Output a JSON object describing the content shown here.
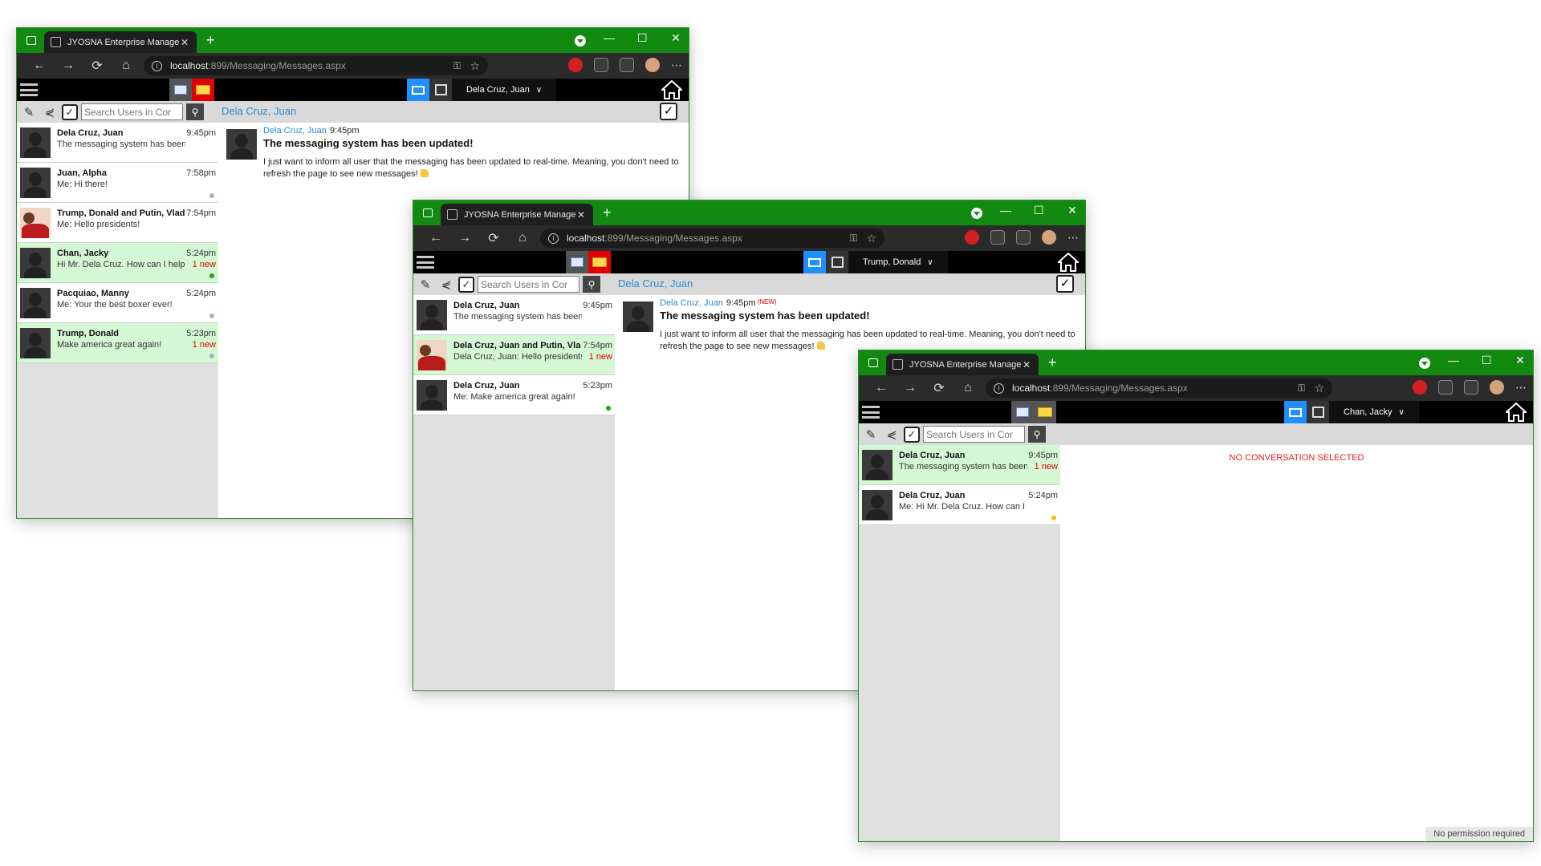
{
  "browser": {
    "tab_title": "JYOSNA Enterprise Management",
    "tab_close": "✕",
    "new_tab": "+",
    "url_host": "localhost",
    "url_path": ":899/Messaging/Messages.aspx",
    "back": "←",
    "forward": "→",
    "reload": "⟳",
    "home": "⌂",
    "menu": "⋯",
    "minimize": "—",
    "maximize": "☐",
    "close": "✕"
  },
  "app": {
    "search_placeholder": "Search Users in Cor",
    "new_message_glyph": "✎",
    "share_glyph": "⋞",
    "check_glyph": "✓",
    "search_glyph": "⚲",
    "chevron": "∨"
  },
  "win1": {
    "user": "Dela Cruz, Juan",
    "conversation_title": "Dela Cruz, Juan",
    "conversations": [
      {
        "name": "Dela Cruz, Juan",
        "time": "9:45pm",
        "preview": "The messaging system has been updated!",
        "new": "",
        "unread": false,
        "dot": ""
      },
      {
        "name": "Juan, Alpha",
        "time": "7:58pm",
        "preview": "Me: Hi there!",
        "new": "",
        "unread": false,
        "dot": "grey"
      },
      {
        "name": "Trump, Donald and Putin, Vladimir",
        "time": "7:54pm",
        "preview": "Me: Hello presidents!",
        "new": "",
        "unread": false,
        "dot": "",
        "group": true
      },
      {
        "name": "Chan, Jacky",
        "time": "5:24pm",
        "preview": "Hi Mr. Dela Cruz. How can I help you?",
        "new": "1 new",
        "unread": true,
        "dot": "green"
      },
      {
        "name": "Pacquiao, Manny",
        "time": "5:24pm",
        "preview": "Me: Your the best boxer ever!",
        "new": "",
        "unread": false,
        "dot": "grey"
      },
      {
        "name": "Trump, Donald",
        "time": "5:23pm",
        "preview": "Make america great again!",
        "new": "1 new",
        "unread": true,
        "dot": "grey"
      }
    ],
    "message": {
      "sender": "Dela Cruz, Juan",
      "time": "9:45pm",
      "new_tag": "",
      "subject": "The messaging system has been updated!",
      "body": "I just want to inform all user that the messaging has been updated to real-time. Meaning, you don't need to refresh the page to see new messages!"
    }
  },
  "win2": {
    "user": "Trump, Donald",
    "conversation_title": "Dela Cruz, Juan",
    "conversations": [
      {
        "name": "Dela Cruz, Juan",
        "time": "9:45pm",
        "preview": "The messaging system has been updated!",
        "new": "",
        "unread": false,
        "dot": ""
      },
      {
        "name": "Dela Cruz, Juan and Putin, Vladimir",
        "time": "7:54pm",
        "preview": "Dela Cruz, Juan: Hello presidents!",
        "new": "1 new",
        "unread": true,
        "dot": "",
        "group": true
      },
      {
        "name": "Dela Cruz, Juan",
        "time": "5:23pm",
        "preview": "Me: Make america great again!",
        "new": "",
        "unread": false,
        "dot": "green"
      }
    ],
    "message": {
      "sender": "Dela Cruz, Juan",
      "time": "9:45pm",
      "new_tag": "(NEW)",
      "subject": "The messaging system has been updated!",
      "body": "I just want to inform all user that the messaging has been updated to real-time. Meaning, you don't need to refresh the page to see new messages!"
    }
  },
  "win3": {
    "user": "Chan, Jacky",
    "no_conversation": "NO CONVERSATION SELECTED",
    "no_permission": "No permission required",
    "conversations": [
      {
        "name": "Dela Cruz, Juan",
        "time": "9:45pm",
        "preview": "The messaging system has been updated!",
        "new": "1 new",
        "unread": true,
        "dot": ""
      },
      {
        "name": "Dela Cruz, Juan",
        "time": "5:24pm",
        "preview": "Me: Hi Mr. Dela Cruz. How can I help you?",
        "new": "",
        "unread": false,
        "dot": "yellow"
      }
    ]
  },
  "colors": {
    "titlebar": "#128a12",
    "accent_blue": "#1e90ff",
    "link_blue": "#2a8ad8",
    "unread_green": "#d4f7d4",
    "alert_red": "#e00000"
  }
}
